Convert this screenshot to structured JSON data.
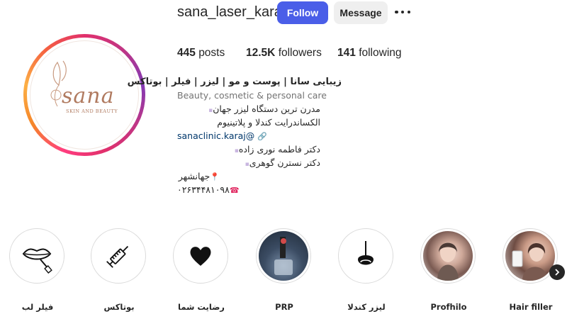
{
  "profile": {
    "username": "sana_laser_karaj",
    "follow_label": "Follow",
    "message_label": "Message",
    "more_icon": "more-options-icon",
    "logo_text": "sana",
    "logo_sub": "SKIN AND BEAUTY"
  },
  "stats": {
    "posts_count": "445",
    "posts_label": "posts",
    "followers_count": "12.5K",
    "followers_label": "followers",
    "following_count": "141",
    "following_label": "following"
  },
  "bio": {
    "name": "زیبایی سانا | پوست و مو | لیزر | فیلر | بوتاکس",
    "category": "Beauty, cosmetic & personal care",
    "line1": "مدرن ترین دستگاه لیزر جهان",
    "line2": "الکساندرایت کندلا و پلاتینیوم",
    "link": "sanaclinic.karaj@",
    "line4": "دکتر فاطمه نوری زاده",
    "line5": "دکتر نسترن گوهری",
    "line6": "جهانشهر",
    "phone": "۰۲۶۳۴۴۸۱۰۹۸"
  },
  "highlights": [
    {
      "label": "فیلر لب",
      "icon": "lips-icon"
    },
    {
      "label": "بوتاکس",
      "icon": "syringe-icon"
    },
    {
      "label": "رضایت شما",
      "icon": "heart-icon"
    },
    {
      "label": "PRP",
      "icon": "prp-photo"
    },
    {
      "label": "لیزر کندلا",
      "icon": "hair-follicle-icon"
    },
    {
      "label": "Profhilo",
      "icon": "profhilo-photo"
    },
    {
      "label": "Hair filler",
      "icon": "hair-filler-photo"
    }
  ],
  "colors": {
    "follow_button": "#4a5ee8",
    "message_button": "#efefef",
    "link": "#00376b",
    "logo": "#b07a5f"
  }
}
